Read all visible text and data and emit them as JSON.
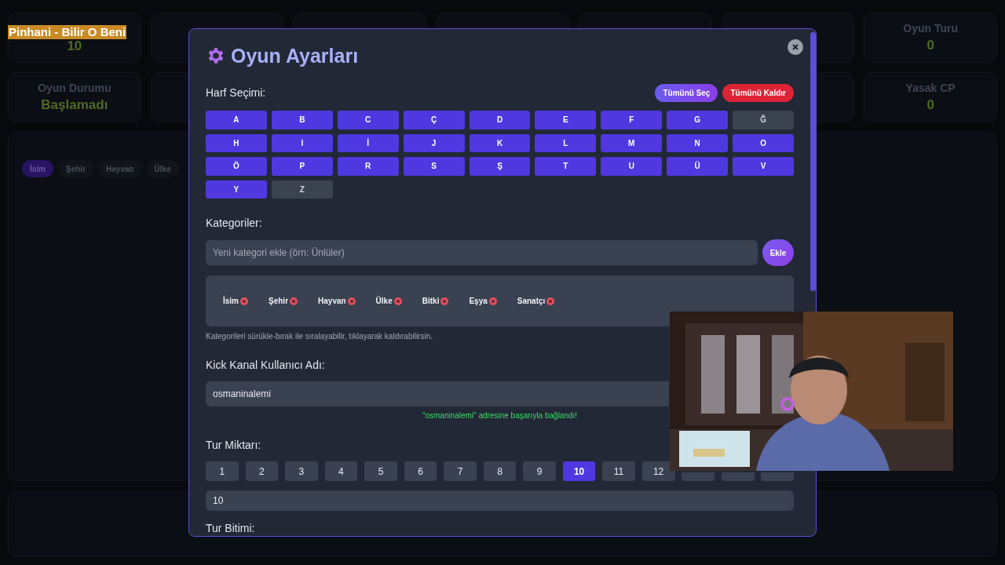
{
  "now_playing": "Pinhani - Bilir O Beni",
  "stats": [
    {
      "cards": [
        {
          "kind": "value",
          "value": "10"
        },
        {
          "kind": "covered"
        },
        {
          "kind": "covered"
        },
        {
          "kind": "covered"
        },
        {
          "kind": "covered"
        },
        {
          "kind": "covered"
        },
        {
          "kind": "stat",
          "label": "Oyun Turu",
          "value": "0"
        }
      ]
    },
    {
      "cards": [
        {
          "kind": "stat",
          "label": "Oyun Durumu",
          "value": "Başlamadı"
        },
        {
          "kind": "covered"
        },
        {
          "kind": "covered"
        },
        {
          "kind": "stat",
          "label": "Yasak CP",
          "value": "0"
        }
      ]
    }
  ],
  "category_tabs": [
    {
      "label": "İsim",
      "selected": true
    },
    {
      "label": "Şehir",
      "selected": false
    },
    {
      "label": "Hayvan",
      "selected": false
    },
    {
      "label": "Ülke",
      "selected": false
    }
  ],
  "settings": {
    "title": "Oyun Ayarları",
    "letters_label": "Harf Seçimi:",
    "select_all": "Tümünü Seç",
    "clear_all": "Tümünü Kaldır",
    "letters": [
      {
        "letter": "A",
        "selected": true
      },
      {
        "letter": "B",
        "selected": true
      },
      {
        "letter": "C",
        "selected": true
      },
      {
        "letter": "Ç",
        "selected": true
      },
      {
        "letter": "D",
        "selected": true
      },
      {
        "letter": "E",
        "selected": true
      },
      {
        "letter": "F",
        "selected": true
      },
      {
        "letter": "G",
        "selected": true
      },
      {
        "letter": "Ğ",
        "selected": false
      },
      {
        "letter": "H",
        "selected": true
      },
      {
        "letter": "I",
        "selected": true
      },
      {
        "letter": "İ",
        "selected": true
      },
      {
        "letter": "J",
        "selected": true
      },
      {
        "letter": "K",
        "selected": true
      },
      {
        "letter": "L",
        "selected": true
      },
      {
        "letter": "M",
        "selected": true
      },
      {
        "letter": "N",
        "selected": true
      },
      {
        "letter": "O",
        "selected": true
      },
      {
        "letter": "Ö",
        "selected": true
      },
      {
        "letter": "P",
        "selected": true
      },
      {
        "letter": "R",
        "selected": true
      },
      {
        "letter": "S",
        "selected": true
      },
      {
        "letter": "Ş",
        "selected": true
      },
      {
        "letter": "T",
        "selected": true
      },
      {
        "letter": "U",
        "selected": true
      },
      {
        "letter": "Ü",
        "selected": true
      },
      {
        "letter": "V",
        "selected": true
      },
      {
        "letter": "Y",
        "selected": true
      },
      {
        "letter": "Z",
        "selected": false
      }
    ],
    "categories_label": "Kategoriler:",
    "category_input": {
      "placeholder": "Yeni kategori ekle (örn: Ünlüler)"
    },
    "add_button": "Ekle",
    "categories": [
      "İsim",
      "Şehir",
      "Hayvan",
      "Ülke",
      "Bitki",
      "Eşya",
      "Sanatçı"
    ],
    "categories_hint": "Kategorileri sürükle-bırak ile sıralayabilir, tıklayarak kaldırabilirsin.",
    "kick_label": "Kick Kanal Kullanıcı Adı:",
    "kick_input": {
      "value": "osmaninalemi"
    },
    "kick_status": "\"osmaninalemi\" adresine başarıyla bağlandı!",
    "rounds_label": "Tur Miktarı:",
    "rounds": [
      {
        "label": "1",
        "selected": false
      },
      {
        "label": "2",
        "selected": false
      },
      {
        "label": "3",
        "selected": false
      },
      {
        "label": "4",
        "selected": false
      },
      {
        "label": "5",
        "selected": false
      },
      {
        "label": "6",
        "selected": false
      },
      {
        "label": "7",
        "selected": false
      },
      {
        "label": "8",
        "selected": false
      },
      {
        "label": "9",
        "selected": false
      },
      {
        "label": "10",
        "selected": true
      },
      {
        "label": "11",
        "selected": false
      },
      {
        "label": "12",
        "selected": false
      },
      {
        "kind": "covered",
        "selected": false
      },
      {
        "kind": "covered",
        "selected": false
      },
      {
        "kind": "covered",
        "selected": false
      }
    ],
    "rounds_input": {
      "value": "10"
    },
    "next_label": "Tur Bitimi:"
  }
}
